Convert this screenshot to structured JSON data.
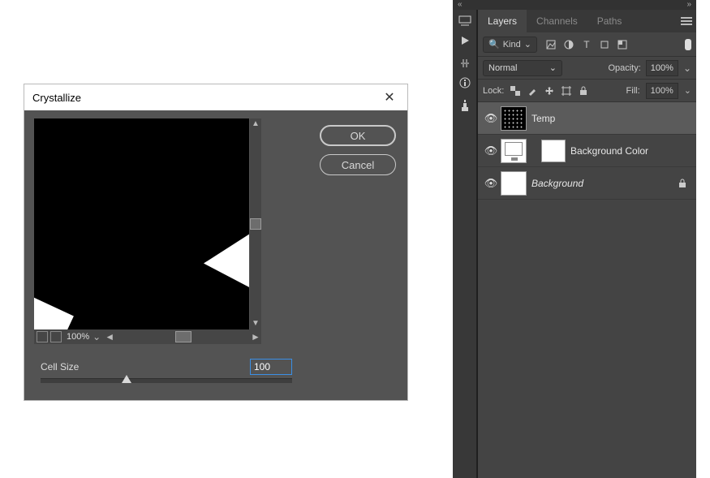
{
  "dialog": {
    "title": "Crystallize",
    "ok_label": "OK",
    "cancel_label": "Cancel",
    "zoom_label": "100%",
    "cellsize_label": "Cell Size",
    "cellsize_value": "100"
  },
  "panel": {
    "collapse_left": "«",
    "collapse_right": "»",
    "tabs": {
      "layers": "Layers",
      "channels": "Channels",
      "paths": "Paths"
    },
    "filter": {
      "kind_label": "Kind"
    },
    "blend": {
      "mode": "Normal",
      "opacity_label": "Opacity:",
      "opacity_value": "100%"
    },
    "lock": {
      "label": "Lock:",
      "fill_label": "Fill:",
      "fill_value": "100%"
    },
    "layers": [
      {
        "name": "Temp"
      },
      {
        "name": "Background Color"
      },
      {
        "name": "Background"
      }
    ]
  }
}
